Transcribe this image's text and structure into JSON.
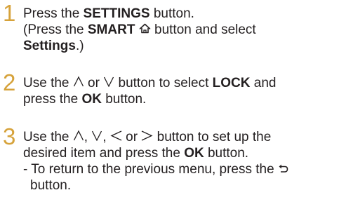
{
  "accent_color": "#d6a23a",
  "text_color": "#231f20",
  "steps": [
    {
      "number": "1",
      "line1": {
        "t1": "Press the ",
        "b1": "SETTINGS",
        "t2": " button."
      },
      "line2": {
        "t1": "(Press the ",
        "b1": "SMART",
        "icon": "home-icon",
        "t2": " button and select"
      },
      "line3": {
        "b1": "Settings",
        "t1": ".)"
      }
    },
    {
      "number": "2",
      "line1": {
        "t1": "Use the ",
        "icon1": "up-icon",
        "t2": " or ",
        "icon2": "down-icon",
        "t3": " button to select ",
        "b1": "LOCK",
        "t4": " and"
      },
      "line2": {
        "t1": "press the ",
        "b1": "OK",
        "t2": " button."
      }
    },
    {
      "number": "3",
      "line1": {
        "t1": "Use the ",
        "icon1": "up-icon",
        "t2": ", ",
        "icon2": "down-icon",
        "t3": ", ",
        "icon3": "left-icon",
        "t4": " or ",
        "icon4": "right-icon",
        "t5": " button to set up the"
      },
      "line2": {
        "t1": "desired item and press the ",
        "b1": "OK",
        "t2": " button."
      },
      "line3": {
        "t1": "- To return to the previous menu, press the ",
        "icon": "back-icon"
      },
      "line4": {
        "t1": "button."
      }
    }
  ]
}
